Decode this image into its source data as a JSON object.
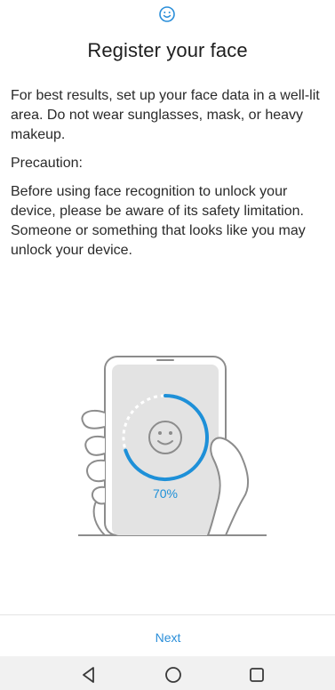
{
  "header": {
    "title": "Register your face",
    "top_icon": "smiley-face-icon"
  },
  "content": {
    "intro": "For best results, set up your face data in a well-lit area. Do not wear sunglasses, mask, or heavy makeup.",
    "precaution_label": "Precaution:",
    "precaution_text": "Before using face recognition to unlock your device, please be aware of its safety limitation. Someone or something that looks like you may unlock your device."
  },
  "illustration": {
    "progress_label": "70%",
    "progress_fraction": 0.7
  },
  "footer": {
    "next_label": "Next"
  },
  "nav_bar": {
    "back_icon": "back-triangle-icon",
    "home_icon": "home-circle-icon",
    "recents_icon": "recents-square-icon"
  },
  "colors": {
    "accent": "#2a8ed9",
    "progress": "#1e90d8",
    "text": "#2a2a2a",
    "nav_bar_bg": "#f1f1f1",
    "phone_screen": "#e3e3e3"
  }
}
